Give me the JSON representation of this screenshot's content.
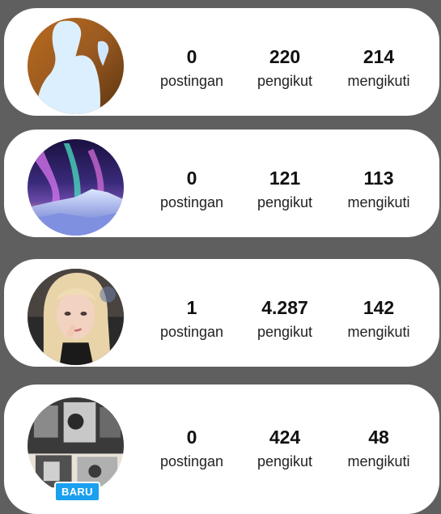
{
  "profiles": [
    {
      "avatar": "silhouette-photo",
      "stats": {
        "posts": {
          "value": "0",
          "label": "postingan"
        },
        "followers": {
          "value": "220",
          "label": "pengikut"
        },
        "following": {
          "value": "214",
          "label": "mengikuti"
        }
      }
    },
    {
      "avatar": "aurora-landscape-photo",
      "stats": {
        "posts": {
          "value": "0",
          "label": "postingan"
        },
        "followers": {
          "value": "121",
          "label": "pengikut"
        },
        "following": {
          "value": "113",
          "label": "mengikuti"
        }
      }
    },
    {
      "avatar": "portrait-photo",
      "stats": {
        "posts": {
          "value": "1",
          "label": "postingan"
        },
        "followers": {
          "value": "4.287",
          "label": "pengikut"
        },
        "following": {
          "value": "142",
          "label": "mengikuti"
        }
      }
    },
    {
      "avatar": "bw-photo-collage",
      "badge": "BARU",
      "stats": {
        "posts": {
          "value": "0",
          "label": "postingan"
        },
        "followers": {
          "value": "424",
          "label": "pengikut"
        },
        "following": {
          "value": "48",
          "label": "mengikuti"
        }
      }
    }
  ],
  "colors": {
    "background": "#5f5f5f",
    "card": "#ffffff",
    "badge": "#1aa0ef"
  }
}
